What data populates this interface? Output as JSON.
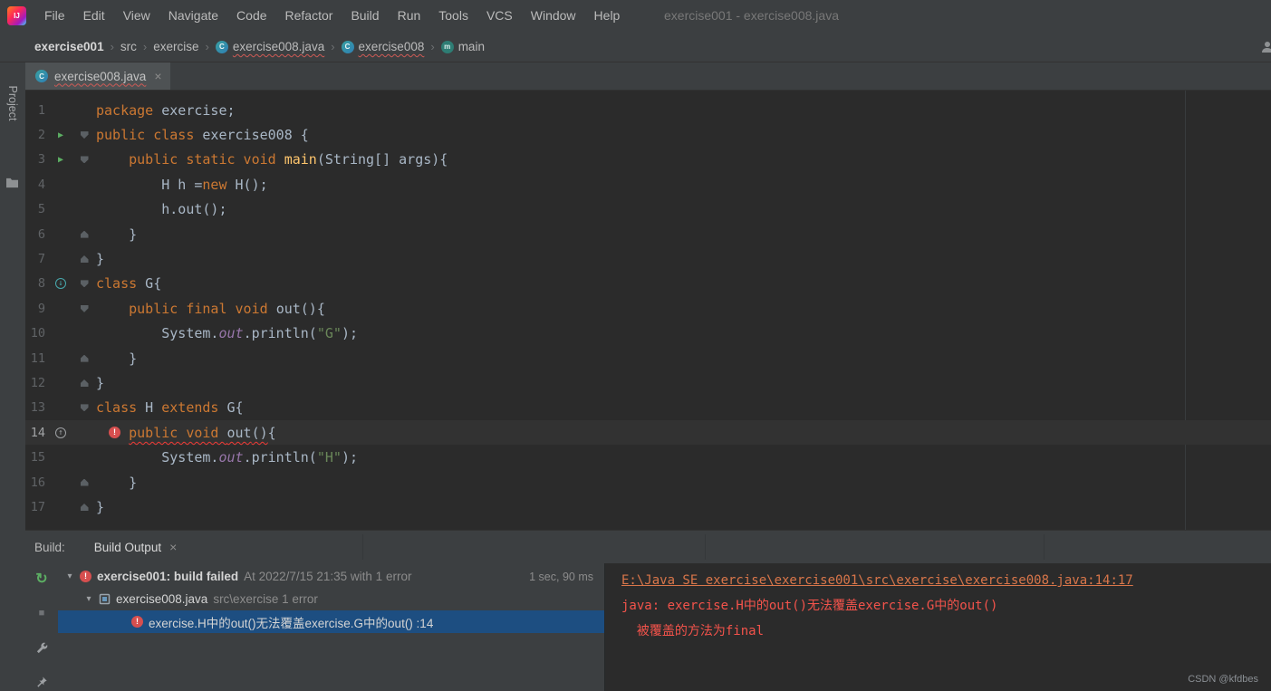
{
  "colors": {
    "panel_bg": "#3c3f41",
    "editor_bg": "#2b2b2b",
    "keyword_orange": "#cc7832",
    "string_green": "#6a8759",
    "method_yellow": "#ffc66d",
    "field_purple": "#9876aa",
    "error_red": "#f3534b",
    "link_orange": "#d9764a",
    "selection_blue": "#1d4e81",
    "run_green": "#5cae63"
  },
  "icons": {
    "logo": "IJ",
    "run_arrow": "▶",
    "chevron_down": "▾",
    "breadcrumb_separator": "›",
    "close": "×",
    "error_bang": "!",
    "class_letter": "C",
    "method_letter": "m",
    "overridden_arrow": "↓",
    "overriding_arrow": "↑",
    "rerun": "↻",
    "stop": "■"
  },
  "menu": {
    "items": [
      "File",
      "Edit",
      "View",
      "Navigate",
      "Code",
      "Refactor",
      "Build",
      "Run",
      "Tools",
      "VCS",
      "Window",
      "Help"
    ],
    "window_title": "exercise001 - exercise008.java"
  },
  "breadcrumbs": [
    {
      "label": "exercise001",
      "bold": true
    },
    {
      "label": "src"
    },
    {
      "label": "exercise"
    },
    {
      "label": "exercise008.java",
      "icon": "class",
      "error": true
    },
    {
      "label": "exercise008",
      "icon": "class",
      "error": true
    },
    {
      "label": "main",
      "icon": "method"
    }
  ],
  "tab": {
    "label": "exercise008.java",
    "close": "×"
  },
  "project_stripe": {
    "label": "Project"
  },
  "editor": {
    "lines": [
      {
        "n": 1,
        "t": [
          [
            "package",
            "k"
          ],
          [
            " exercise;",
            "p"
          ]
        ]
      },
      {
        "n": 2,
        "g": "run",
        "f": "s",
        "t": [
          [
            "public class ",
            "k"
          ],
          [
            "exercise008 {",
            "p"
          ]
        ]
      },
      {
        "n": 3,
        "g": "run",
        "f": "s",
        "t": [
          [
            "    ",
            "p"
          ],
          [
            "public static void ",
            "k"
          ],
          [
            "main",
            "d"
          ],
          [
            "(String[] args){",
            "p"
          ]
        ]
      },
      {
        "n": 4,
        "t": [
          [
            "        H h =",
            "p"
          ],
          [
            "new",
            "k"
          ],
          [
            " H();",
            "p"
          ]
        ]
      },
      {
        "n": 5,
        "t": [
          [
            "        h.out();",
            "p"
          ]
        ]
      },
      {
        "n": 6,
        "f": "e",
        "t": [
          [
            "    }",
            "p"
          ]
        ]
      },
      {
        "n": 7,
        "f": "e",
        "t": [
          [
            "}",
            "p"
          ]
        ]
      },
      {
        "n": 8,
        "g": "ovrd",
        "f": "s",
        "t": [
          [
            "class",
            "k"
          ],
          [
            " G{",
            "p"
          ]
        ]
      },
      {
        "n": 9,
        "f": "s",
        "t": [
          [
            "    ",
            "p"
          ],
          [
            "public final void ",
            "k"
          ],
          [
            "out(){",
            "p"
          ]
        ]
      },
      {
        "n": 10,
        "t": [
          [
            "        System.",
            "p"
          ],
          [
            "out",
            "fl"
          ],
          [
            ".println(",
            "p"
          ],
          [
            "\"G\"",
            "st"
          ],
          [
            ");",
            "p"
          ]
        ]
      },
      {
        "n": 11,
        "f": "e",
        "t": [
          [
            "    }",
            "p"
          ]
        ]
      },
      {
        "n": 12,
        "f": "e",
        "t": [
          [
            "}",
            "p"
          ]
        ]
      },
      {
        "n": 13,
        "f": "s",
        "t": [
          [
            "class",
            "k"
          ],
          [
            " H ",
            "p"
          ],
          [
            "extends",
            "k"
          ],
          [
            " G{",
            "p"
          ]
        ]
      },
      {
        "n": 14,
        "g": "ovru",
        "b": true,
        "h": true,
        "t": [
          [
            "    ",
            "p"
          ],
          [
            "public void ",
            "k e"
          ],
          [
            "out",
            "p e"
          ],
          [
            "()",
            "p e"
          ],
          [
            "{",
            "p"
          ]
        ]
      },
      {
        "n": 15,
        "t": [
          [
            "        System.",
            "p"
          ],
          [
            "out",
            "fl"
          ],
          [
            ".println(",
            "p"
          ],
          [
            "\"H\"",
            "st"
          ],
          [
            ");",
            "p"
          ]
        ]
      },
      {
        "n": 16,
        "f": "e",
        "t": [
          [
            "    }",
            "p"
          ]
        ]
      },
      {
        "n": 17,
        "f": "e",
        "t": [
          [
            "}",
            "p"
          ]
        ]
      }
    ]
  },
  "build": {
    "panel_label": "Build:",
    "tab": {
      "label": "Build Output",
      "close": "×"
    },
    "tree": [
      {
        "level": 1,
        "chevron": true,
        "icon": "error",
        "bold": true,
        "title": "exercise001: build failed",
        "subtitle": "At 2022/7/15 21:35 with 1 error",
        "duration": "1 sec, 90 ms",
        "selected": false
      },
      {
        "level": 2,
        "chevron": true,
        "icon": "module",
        "bold": false,
        "title": "exercise008.java",
        "subtitle": "src\\exercise 1 error",
        "selected": false
      },
      {
        "level": 3,
        "chevron": false,
        "icon": "error",
        "bold": false,
        "title": "exercise.H中的out()无法覆盖exercise.G中的out() :14",
        "selected": true
      }
    ],
    "console": [
      {
        "type": "link",
        "text": "E:\\Java SE exercise\\exercise001\\src\\exercise\\exercise008.java:14:17"
      },
      {
        "type": "error",
        "text": "java: exercise.H中的out()无法覆盖exercise.G中的out()"
      },
      {
        "type": "error",
        "text": "  被覆盖的方法为final"
      }
    ]
  },
  "watermark": "CSDN @kfdbes"
}
